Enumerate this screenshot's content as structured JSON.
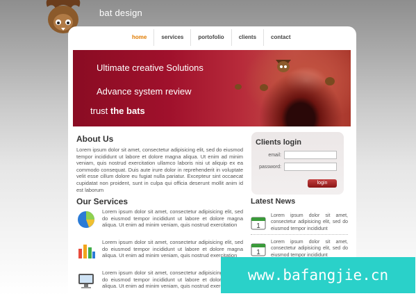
{
  "header": {
    "site_title": "bat design",
    "mascot_icon": "bat-mascot-icon"
  },
  "nav": {
    "items": [
      {
        "label": "home",
        "active": true
      },
      {
        "label": "services",
        "active": false
      },
      {
        "label": "portofolio",
        "active": false
      },
      {
        "label": "clients",
        "active": false
      },
      {
        "label": "contact",
        "active": false
      }
    ],
    "active_color": "#e07b00"
  },
  "banner": {
    "line1": "Ultimate creative Solutions",
    "line2": "Advance system review",
    "line3_prefix": "trust ",
    "line3_bold": "the bats"
  },
  "about": {
    "title": "About Us",
    "text": "Lorem ipsum dolor sit amet, consectetur adipisicing elit, sed do eiusmod tempor incididunt ut labore et dolore magna aliqua. Ut enim ad minim veniam, quis nostrud exercitation ullamco laboris nisi ut aliquip ex ea commodo consequat. Duis aute irure dolor in reprehenderit in voluptate velit esse cillum dolore eu fugiat nulla pariatur. Excepteur sint occaecat cupidatat non proident, sunt in culpa qui officia deserunt mollit anim id est laborum"
  },
  "services": {
    "title": "Our Services",
    "items": [
      {
        "icon": "pie-chart-icon",
        "text": "Lorem ipsum dolor sit amet, consectetur adipisicing elit, sed do eiusmod tempor incididunt ut labore et dolore magna aliqua. Ut enim ad minim veniam, quis nostrud exercitation"
      },
      {
        "icon": "bar-chart-icon",
        "text": "Lorem ipsum dolor sit amet, consectetur adipisicing elit, sed do eiusmod tempor incididunt ut labore et dolore magna aliqua. Ut enim ad minim veniam, quis nostrud exercitation"
      },
      {
        "icon": "monitor-icon",
        "text": "Lorem ipsum dolor sit amet, consectetur adipisicing elit, sed do eiusmod tempor incididunt ut labore et dolore magna aliqua. Ut enim ad minim veniam, quis nostrud exercitation"
      }
    ]
  },
  "login": {
    "title": "Clients login",
    "email_label": "email:",
    "password_label": "password:",
    "button_label": "login"
  },
  "news": {
    "title": "Latest News",
    "items": [
      {
        "icon": "calendar-icon",
        "date_number": "1",
        "text": "Lorem ipsum dolor sit amet, consectetur adipisicing elit, sed do eiusmod tempor incididunt"
      },
      {
        "icon": "calendar-icon",
        "date_number": "1",
        "text": "Lorem ipsum dolor sit amet, consectetur adipisicing elit, sed do eiusmod tempor incididunt"
      }
    ]
  },
  "watermark": {
    "text": "www.bafangjie.cn"
  }
}
